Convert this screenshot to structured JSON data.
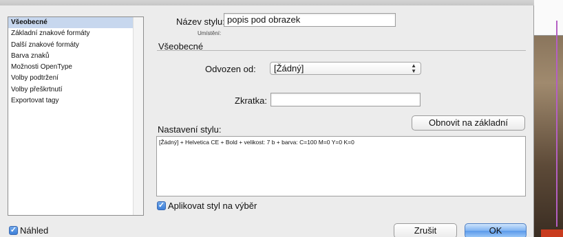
{
  "dialog": {
    "categories": [
      {
        "label": "Všeobecné",
        "selected": true
      },
      {
        "label": "Základní znakové formáty",
        "selected": false
      },
      {
        "label": "Další znakové formáty",
        "selected": false
      },
      {
        "label": "Barva znaků",
        "selected": false
      },
      {
        "label": "Možnosti OpenType",
        "selected": false
      },
      {
        "label": "Volby podtržení",
        "selected": false
      },
      {
        "label": "Volby přeškrtnutí",
        "selected": false
      },
      {
        "label": "Exportovat tagy",
        "selected": false
      }
    ],
    "style_name_label": "Název stylu:",
    "style_name_value": "popis pod obrazek",
    "location_label": "Umístění:",
    "section_title": "Všeobecné",
    "based_on_label": "Odvozen od:",
    "based_on_value": "[Žádný]",
    "shortcut_label": "Zkratka:",
    "shortcut_value": "",
    "reset_button": "Obnovit na základní",
    "style_settings_label": "Nastavení stylu:",
    "style_settings_text": "[Žádný] + Helvetica CE + Bold + velikost: 7 b + barva: C=100 M=0 Y=0 K=0",
    "apply_checkbox_label": "Aplikovat styl na výběr",
    "apply_checked": true,
    "preview_label": "Náhled",
    "preview_checked": true,
    "cancel_button": "Zrušit",
    "ok_button": "OK"
  },
  "colors": {
    "selection": "#c7d7ee",
    "primary_button": "#5b9aea",
    "checkbox": "#3d7fd8"
  }
}
